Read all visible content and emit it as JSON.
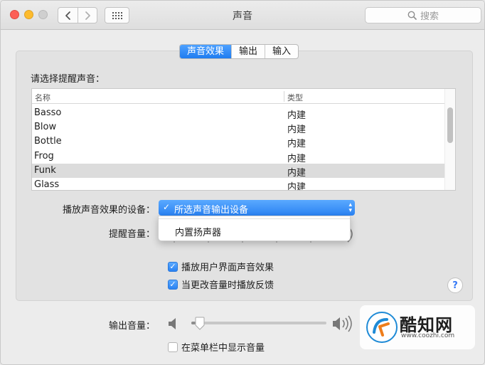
{
  "window": {
    "title": "声音",
    "search_placeholder": "搜索"
  },
  "tabs": [
    {
      "label": "声音效果",
      "active": true
    },
    {
      "label": "输出",
      "active": false
    },
    {
      "label": "输入",
      "active": false
    }
  ],
  "alert_section": {
    "label": "请选择提醒声音：",
    "columns": [
      "名称",
      "类型"
    ],
    "rows": [
      {
        "name": "Basso",
        "type": "内建",
        "selected": false
      },
      {
        "name": "Blow",
        "type": "内建",
        "selected": false
      },
      {
        "name": "Bottle",
        "type": "内建",
        "selected": false
      },
      {
        "name": "Frog",
        "type": "内建",
        "selected": false
      },
      {
        "name": "Funk",
        "type": "内建",
        "selected": true
      },
      {
        "name": "Glass",
        "type": "内建",
        "selected": false
      }
    ]
  },
  "play_through": {
    "label": "播放声音效果的设备：",
    "selected": "所选声音输出设备",
    "options": [
      "所选声音输出设备",
      "内置扬声器"
    ]
  },
  "alert_volume": {
    "label": "提醒音量："
  },
  "checkboxes": [
    {
      "label": "播放用户界面声音效果",
      "checked": true
    },
    {
      "label": "当更改音量时播放反馈",
      "checked": true
    }
  ],
  "help_label": "?",
  "output_volume": {
    "label": "输出音量：",
    "level": 0.03
  },
  "menubar_checkbox": {
    "label": "在菜单栏中显示音量",
    "checked": false
  },
  "watermark": {
    "name": "酷知网",
    "url": "www.coozhi.com"
  },
  "colors": {
    "accent": "#2a82f2",
    "selected_row": "#dcdcdc",
    "close": "#fc5f57",
    "minimize": "#fdbb2d"
  }
}
